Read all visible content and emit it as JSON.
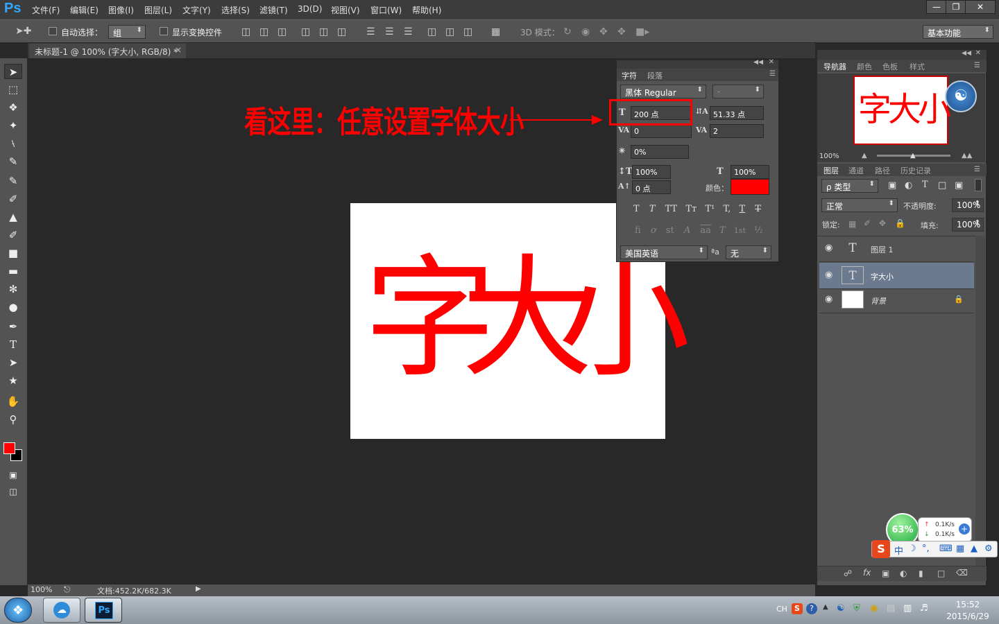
{
  "app": {
    "logo": "Ps"
  },
  "menubar": {
    "items": [
      "文件(F)",
      "编辑(E)",
      "图像(I)",
      "图层(L)",
      "文字(Y)",
      "选择(S)",
      "滤镜(T)",
      "3D(D)",
      "视图(V)",
      "窗口(W)",
      "帮助(H)"
    ]
  },
  "options": {
    "auto_select_label": "自动选择：",
    "auto_select_value": "组",
    "show_transform_label": "显示变换控件",
    "mode_3d_label": "3D 模式：",
    "workspace": "基本功能"
  },
  "document": {
    "tab_title": "未标题-1 @ 100% (字大小, RGB/8) *"
  },
  "canvas": {
    "chars": [
      "字",
      "大",
      "小"
    ],
    "text_color": "#ff0000"
  },
  "annotation": {
    "text": "看这里：任意设置字体大小"
  },
  "char_panel": {
    "tabs": [
      "字符",
      "段落"
    ],
    "font_family": "黑体 Regular",
    "font_style": "-",
    "font_size": "200 点",
    "leading": "51.33 点",
    "kerning": "0",
    "tracking": "2",
    "tsume": "0%",
    "vert_scale": "100%",
    "horiz_scale": "100%",
    "baseline_shift": "0 点",
    "color_label": "颜色：",
    "color_value": "#ff0000",
    "style_buttons": [
      "T",
      "T",
      "TT",
      "Tт",
      "T¹",
      "T,",
      "T",
      "T"
    ],
    "opentype_buttons": [
      "fi",
      "ơ",
      "st",
      "A",
      "aa",
      "T",
      "1st",
      "½"
    ],
    "language": "美国英语",
    "aa_label": "ªa",
    "antialias": "无"
  },
  "right_panel": {
    "top_tabs": [
      "导航器",
      "颜色",
      "色板",
      "样式"
    ],
    "nav_zoom": "100%",
    "nav_chars": [
      "字",
      "大",
      "小"
    ],
    "layer_tabs": [
      "图层",
      "通道",
      "路径",
      "历史记录"
    ],
    "filter_kind": "ρ 类型",
    "blend_mode": "正常",
    "opacity_label": "不透明度:",
    "opacity": "100%",
    "lock_label": "锁定:",
    "fill_label": "填充:",
    "fill": "100%",
    "layers": [
      {
        "name": "图层 1",
        "type": "text"
      },
      {
        "name": "字大小",
        "type": "text"
      },
      {
        "name": "背景",
        "type": "background"
      }
    ]
  },
  "statusbar": {
    "zoom": "100%",
    "doc_info": "文档:452.2K/682.3K"
  },
  "widget": {
    "percent": "63%",
    "up_speed": "0.1K/s",
    "down_speed": "0.1K/s"
  },
  "taskbar": {
    "lang": "CH",
    "time": "15:52",
    "date": "2015/6/29"
  }
}
